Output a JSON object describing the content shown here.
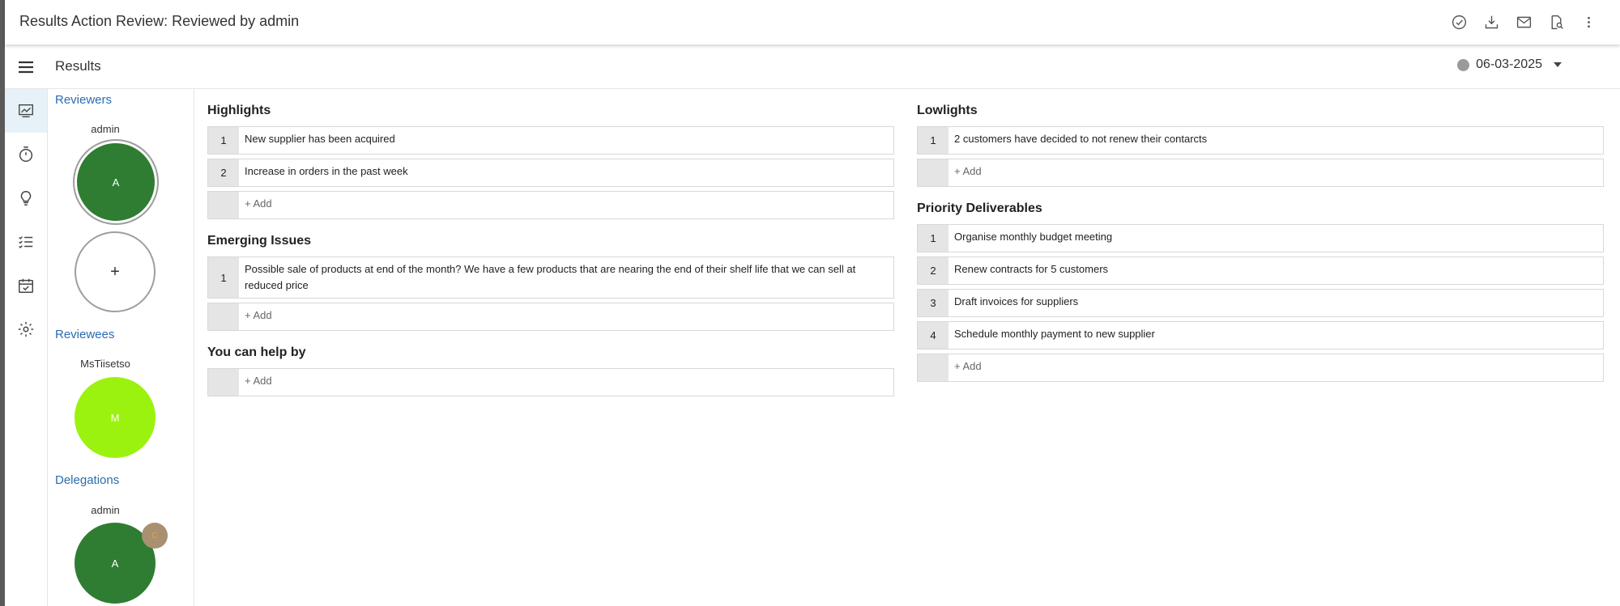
{
  "header": {
    "title": "Results Action Review: Reviewed by admin",
    "icons": [
      "check-circle-icon",
      "download-icon",
      "email-icon",
      "document-search-icon",
      "more-vert-icon"
    ]
  },
  "results_bar": {
    "label": "Results",
    "date": "06-03-2025",
    "date_dot_color": "#9a9a9a"
  },
  "rail": {
    "items": [
      "chart-icon",
      "timer-icon",
      "lightbulb-icon",
      "checklist-icon",
      "calendar-check-icon",
      "settings-icon"
    ],
    "active_index": 0
  },
  "people": {
    "reviewers": {
      "heading": "Reviewers",
      "name": "admin",
      "initial": "A",
      "add_symbol": "+"
    },
    "reviewees": {
      "heading": "Reviewees",
      "name": "MsTiisetso",
      "initial": "M"
    },
    "delegations": {
      "heading": "Delegations",
      "name": "admin",
      "initial": "A",
      "badge": "C"
    }
  },
  "colors": {
    "accent_blue": "#2b6cb0",
    "avatar_green": "#2e7d32",
    "avatar_lime": "#9cf20f"
  },
  "highlights": {
    "title": "Highlights",
    "items": [
      {
        "num": "1",
        "text": "New supplier has been acquired"
      },
      {
        "num": "2",
        "text": "Increase in orders in the past week"
      }
    ],
    "add_label": "+ Add"
  },
  "emerging": {
    "title": "Emerging Issues",
    "items": [
      {
        "num": "1",
        "text": "Possible sale of products at end of the month? We have a few products that are nearing the end of their shelf life that we can sell at reduced price"
      }
    ],
    "add_label": "+ Add"
  },
  "help": {
    "title": "You can help by",
    "add_label": "+ Add"
  },
  "lowlights": {
    "title": "Lowlights",
    "items": [
      {
        "num": "1",
        "text": "2 customers have decided to not renew their contarcts"
      }
    ],
    "add_label": "+ Add"
  },
  "priority": {
    "title": "Priority Deliverables",
    "items": [
      {
        "num": "1",
        "text": "Organise monthly budget meeting"
      },
      {
        "num": "2",
        "text": "Renew contracts for 5 customers"
      },
      {
        "num": "3",
        "text": "Draft invoices for suppliers"
      },
      {
        "num": "4",
        "text": "Schedule monthly payment to new supplier"
      }
    ],
    "add_label": "+ Add"
  }
}
